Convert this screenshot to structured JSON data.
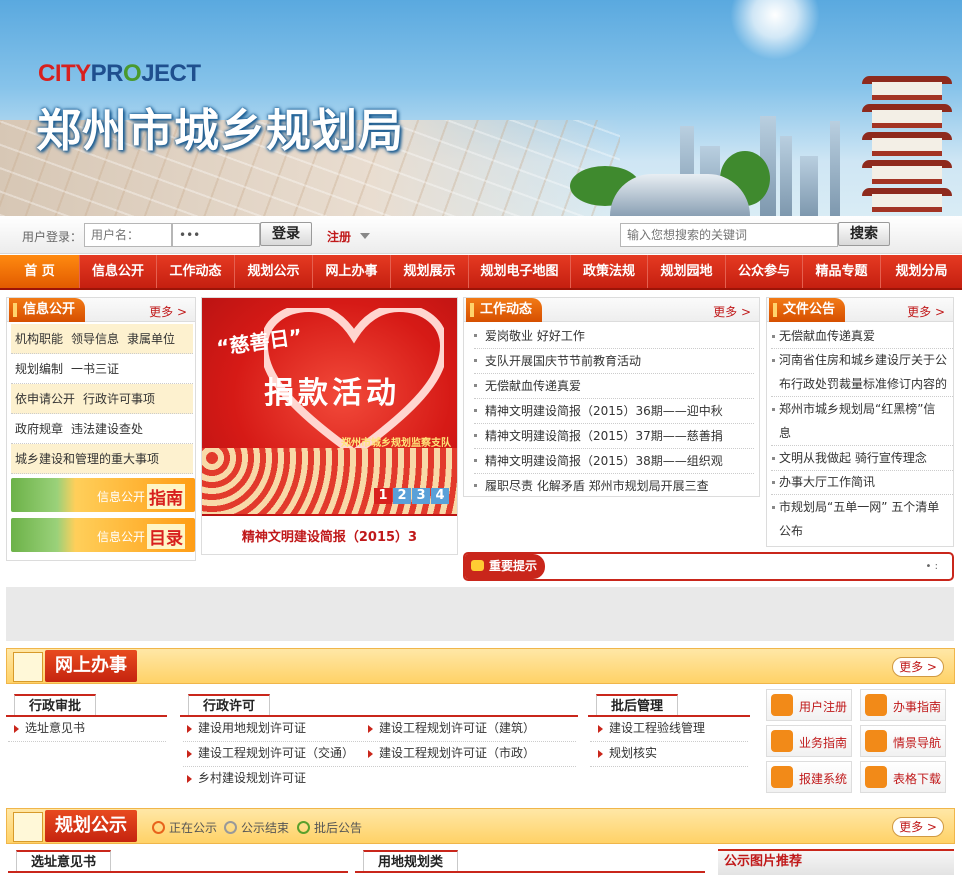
{
  "banner": {
    "logo_a": "CITY",
    "logo_b": "PR",
    "logo_c": "O",
    "logo_d": "JECT",
    "title": "郑州市城乡规划局"
  },
  "login": {
    "label": "用户登录：",
    "username_placeholder": "用户名：",
    "password_value": "•••",
    "login_button": "登录",
    "register": "注册",
    "search_placeholder": "输入您想搜索的关键词",
    "search_button": "搜索"
  },
  "nav": [
    "首 页",
    "信息公开",
    "工作动态",
    "规划公示",
    "网上办事",
    "规划展示",
    "规划电子地图",
    "政策法规",
    "规划园地",
    "公众参与",
    "精品专题",
    "规划分局"
  ],
  "info": {
    "title": "信息公开",
    "more": "更多 >",
    "rows": [
      [
        "机构职能",
        "领导信息",
        "隶属单位"
      ],
      [
        "规划编制",
        "一书三证"
      ],
      [
        "依申请公开",
        "行政许可事项"
      ],
      [
        "政府规章",
        "违法建设查处"
      ],
      [
        "城乡建设和管理的重大事项"
      ]
    ],
    "btn1_a": "信息公开",
    "btn1_b": "指南",
    "btn2_a": "信息公开",
    "btn2_b": "目录"
  },
  "slide": {
    "cap1": "“慈善日”",
    "cap2": "捐款活动",
    "cap3": "郑州市城乡规划监察支队",
    "pages": [
      "1",
      "2",
      "3",
      "4"
    ],
    "caption": "精神文明建设简报（2015）3"
  },
  "work": {
    "title": "工作动态",
    "more": "更多 >",
    "items": [
      "爱岗敬业 好好工作",
      "支队开展国庆节节前教育活动",
      "无偿献血传递真爱",
      "精神文明建设简报（2015）36期——迎中秋",
      "精神文明建设简报（2015）37期——慈善捐",
      "精神文明建设简报（2015）38期——组织观",
      "履职尽责 化解矛盾 郑州市规划局开展三查"
    ]
  },
  "docs": {
    "title": "文件公告",
    "more": "更多 >",
    "items": [
      [
        "无偿献血传递真爱"
      ],
      [
        "河南省住房和城乡建设厅关于公",
        "布行政处罚裁量标准修订内容的"
      ],
      [
        "郑州市城乡规划局“红黑榜”信",
        "息"
      ],
      [
        "文明从我做起 骑行宣传理念"
      ],
      [
        "办事大厅工作简讯"
      ],
      [
        "市规划局“五单一网” 五个清单",
        "公布"
      ]
    ]
  },
  "notice": {
    "label": "重要提示",
    "dots": "• :"
  },
  "online": {
    "title": "网上办事",
    "more": "更多 >",
    "tab1": "行政审批",
    "tab1_items": [
      "选址意见书"
    ],
    "tab2": "行政许可",
    "tab2_items": [
      "建设用地规划许可证",
      "建设工程规划许可证（建筑）",
      "建设工程规划许可证（交通）",
      "建设工程规划许可证（市政）",
      "乡村建设规划许可证"
    ],
    "tab3": "批后管理",
    "tab3_items": [
      "建设工程验线管理",
      "规划核实"
    ],
    "quick": [
      "用户注册",
      "办事指南",
      "业务指南",
      "情景导航",
      "报建系统",
      "表格下载"
    ]
  },
  "gongshi": {
    "title": "规划公示",
    "more": "更多 >",
    "legend": [
      "正在公示",
      "公示结束",
      "批后公告"
    ],
    "tab1": "选址意见书",
    "tab2": "用地规划类",
    "pic": "公示图片推荐"
  }
}
